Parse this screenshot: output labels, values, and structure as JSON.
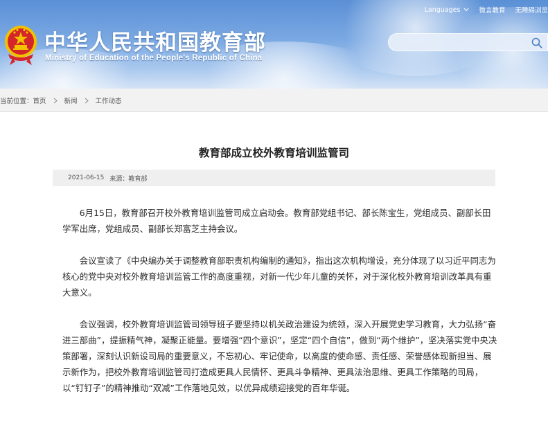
{
  "header": {
    "title": "中华人民共和国教育部",
    "subtitle": "Ministry of Education of the People's Republic of China",
    "links": {
      "languages": "Languages",
      "weibo": "微言教育",
      "accessibility": "无障碍浏览"
    },
    "search": {
      "value": "",
      "placeholder": ""
    }
  },
  "breadcrumb": {
    "prefix": "当前位置：",
    "items": [
      "首页",
      "新闻",
      "工作动态"
    ]
  },
  "article": {
    "title": "教育部成立校外教育培训监管司",
    "date": "2021-06-15",
    "source": "来源：教育部",
    "paragraphs": [
      "6月15日，教育部召开校外教育培训监管司成立启动会。教育部党组书记、部长陈宝生，党组成员、副部长田学军出席，党组成员、副部长郑富芝主持会议。",
      "会议宣读了《中央编办关于调整教育部职责机构编制的通知》，指出这次机构增设，充分体现了以习近平同志为核心的党中央对校外教育培训监管工作的高度重视，对新一代少年儿童的关怀，对于深化校外教育培训改革具有重大意义。",
      "会议强调，校外教育培训监管司领导班子要坚持以机关政治建设为统领，深入开展党史学习教育，大力弘扬“奋进三部曲”，提振精气神，凝聚正能量。要增强“四个意识”，坚定“四个自信”，做到“两个维护”，坚决落实党中央决策部署，深刻认识新设司局的重要意义，不忘初心、牢记使命，以高度的使命感、责任感、荣誉感体现新担当、展示新作为，把校外教育培训监管司打造成更具人民情怀、更具斗争精神、更具法治思维、更具工作策略的司局，以“钉钉子”的精神推动“双减”工作落地见效，以优异成绩迎接党的百年华诞。"
    ]
  },
  "icons": {
    "emblem": "national-emblem-icon",
    "search": "search-icon",
    "chevron": "chevron-down-icon",
    "separator": "chevron-right-icon"
  },
  "colors": {
    "header_top": "#5b90d6",
    "header_bottom": "#d4e3f6",
    "emblem_red": "#d4262a",
    "emblem_gold": "#f2c200"
  }
}
